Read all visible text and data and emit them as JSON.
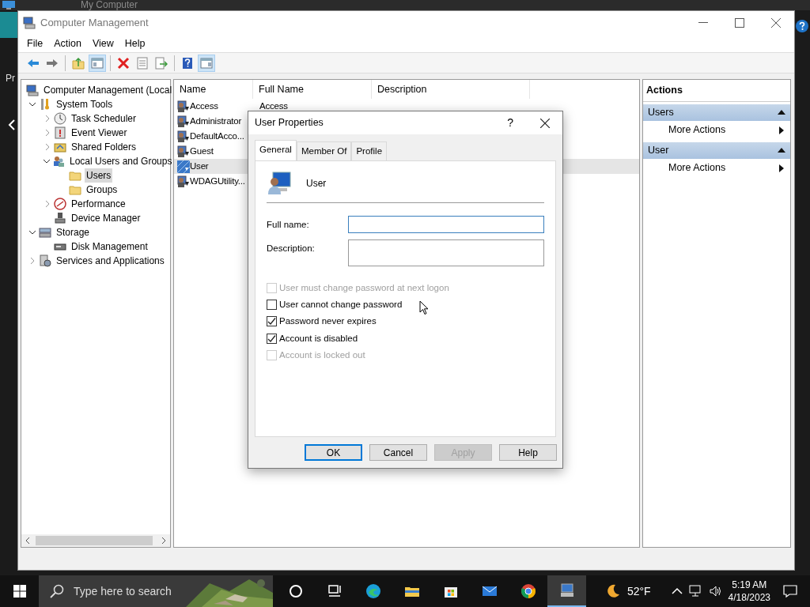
{
  "background_window": {
    "title": "My Computer",
    "side_text": "Pr"
  },
  "window": {
    "title": "Computer Management"
  },
  "menu": [
    "File",
    "Action",
    "View",
    "Help"
  ],
  "toolbar": [
    {
      "kind": "back",
      "pressed": false
    },
    {
      "kind": "forward",
      "pressed": false
    },
    {
      "kind": "up",
      "pressed": false
    },
    {
      "kind": "console-tree",
      "pressed": true
    },
    {
      "kind": "delete",
      "pressed": false
    },
    {
      "kind": "properties",
      "pressed": false
    },
    {
      "kind": "export",
      "pressed": false
    },
    {
      "kind": "help",
      "pressed": false
    },
    {
      "kind": "action-pane",
      "pressed": true
    }
  ],
  "tree": [
    {
      "label": "Computer Management (Local",
      "kind": "computer",
      "selected": false,
      "children": [
        {
          "label": "System Tools",
          "kind": "tools",
          "expanded": true,
          "selected": false,
          "children": [
            {
              "label": "Task Scheduler",
              "kind": "clock",
              "expanded": false,
              "selected": false
            },
            {
              "label": "Event Viewer",
              "kind": "event",
              "expanded": false,
              "selected": false
            },
            {
              "label": "Shared Folders",
              "kind": "share",
              "expanded": false,
              "selected": false
            },
            {
              "label": "Local Users and Groups",
              "kind": "users",
              "expanded": true,
              "selected": false,
              "children": [
                {
                  "label": "Users",
                  "kind": "folder",
                  "selected": true
                },
                {
                  "label": "Groups",
                  "kind": "folder",
                  "selected": false
                }
              ]
            },
            {
              "label": "Performance",
              "kind": "performance",
              "expanded": false,
              "selected": false
            },
            {
              "label": "Device Manager",
              "kind": "device",
              "selected": false
            }
          ]
        },
        {
          "label": "Storage",
          "kind": "storage",
          "expanded": true,
          "selected": false,
          "children": [
            {
              "label": "Disk Management",
              "kind": "disk",
              "selected": false
            }
          ]
        },
        {
          "label": "Services and Applications",
          "kind": "services",
          "expanded": false,
          "selected": false
        }
      ]
    }
  ],
  "list": {
    "columns": [
      "Name",
      "Full Name",
      "Description"
    ],
    "rows": [
      {
        "name": "Access",
        "full_name": "Access",
        "selected": false
      },
      {
        "name": "Administrator",
        "selected": false
      },
      {
        "name": "DefaultAcco...",
        "selected": false
      },
      {
        "name": "Guest",
        "selected": false
      },
      {
        "name": "User",
        "selected": true
      },
      {
        "name": "WDAGUtility...",
        "selected": false
      }
    ]
  },
  "actions": {
    "title": "Actions",
    "sections": [
      {
        "title": "Users",
        "expanded": true,
        "items": [
          "More Actions"
        ]
      },
      {
        "title": "User",
        "expanded": true,
        "items": [
          "More Actions"
        ]
      }
    ]
  },
  "dialog": {
    "title": "User Properties",
    "help": "?",
    "tabs": [
      {
        "label": "General",
        "selected": true
      },
      {
        "label": "Member Of",
        "selected": false
      },
      {
        "label": "Profile",
        "selected": false
      }
    ],
    "user_name": "User",
    "fields": [
      {
        "label": "Full name:",
        "focused": true,
        "multiline": false
      },
      {
        "label": "Description:",
        "focused": false,
        "multiline": true
      }
    ],
    "checkboxes": [
      {
        "label": "User must change password at next logon",
        "checked": false,
        "disabled": true
      },
      {
        "label": "User cannot change password",
        "checked": false,
        "disabled": false
      },
      {
        "label": "Password never expires",
        "checked": true,
        "disabled": false
      },
      {
        "label": "Account is disabled",
        "checked": true,
        "disabled": false
      },
      {
        "label": "Account is locked out",
        "checked": false,
        "disabled": true
      }
    ],
    "buttons": [
      {
        "label": "OK",
        "default": true,
        "disabled": false
      },
      {
        "label": "Cancel",
        "default": false,
        "disabled": false
      },
      {
        "label": "Apply",
        "default": false,
        "disabled": true
      },
      {
        "label": "Help",
        "default": false,
        "disabled": false
      }
    ]
  },
  "taskbar": {
    "search_placeholder": "Type here to search",
    "apps": [
      {
        "kind": "cortana",
        "active": false
      },
      {
        "kind": "task-view",
        "active": false
      },
      {
        "kind": "edge",
        "active": false
      },
      {
        "kind": "explorer",
        "active": false
      },
      {
        "kind": "store",
        "active": false
      },
      {
        "kind": "mail",
        "active": false
      },
      {
        "kind": "chrome",
        "active": false
      },
      {
        "kind": "computer-management",
        "active": true
      }
    ],
    "weather": "52°F",
    "time": "5:19 AM",
    "date": "4/18/2023"
  }
}
